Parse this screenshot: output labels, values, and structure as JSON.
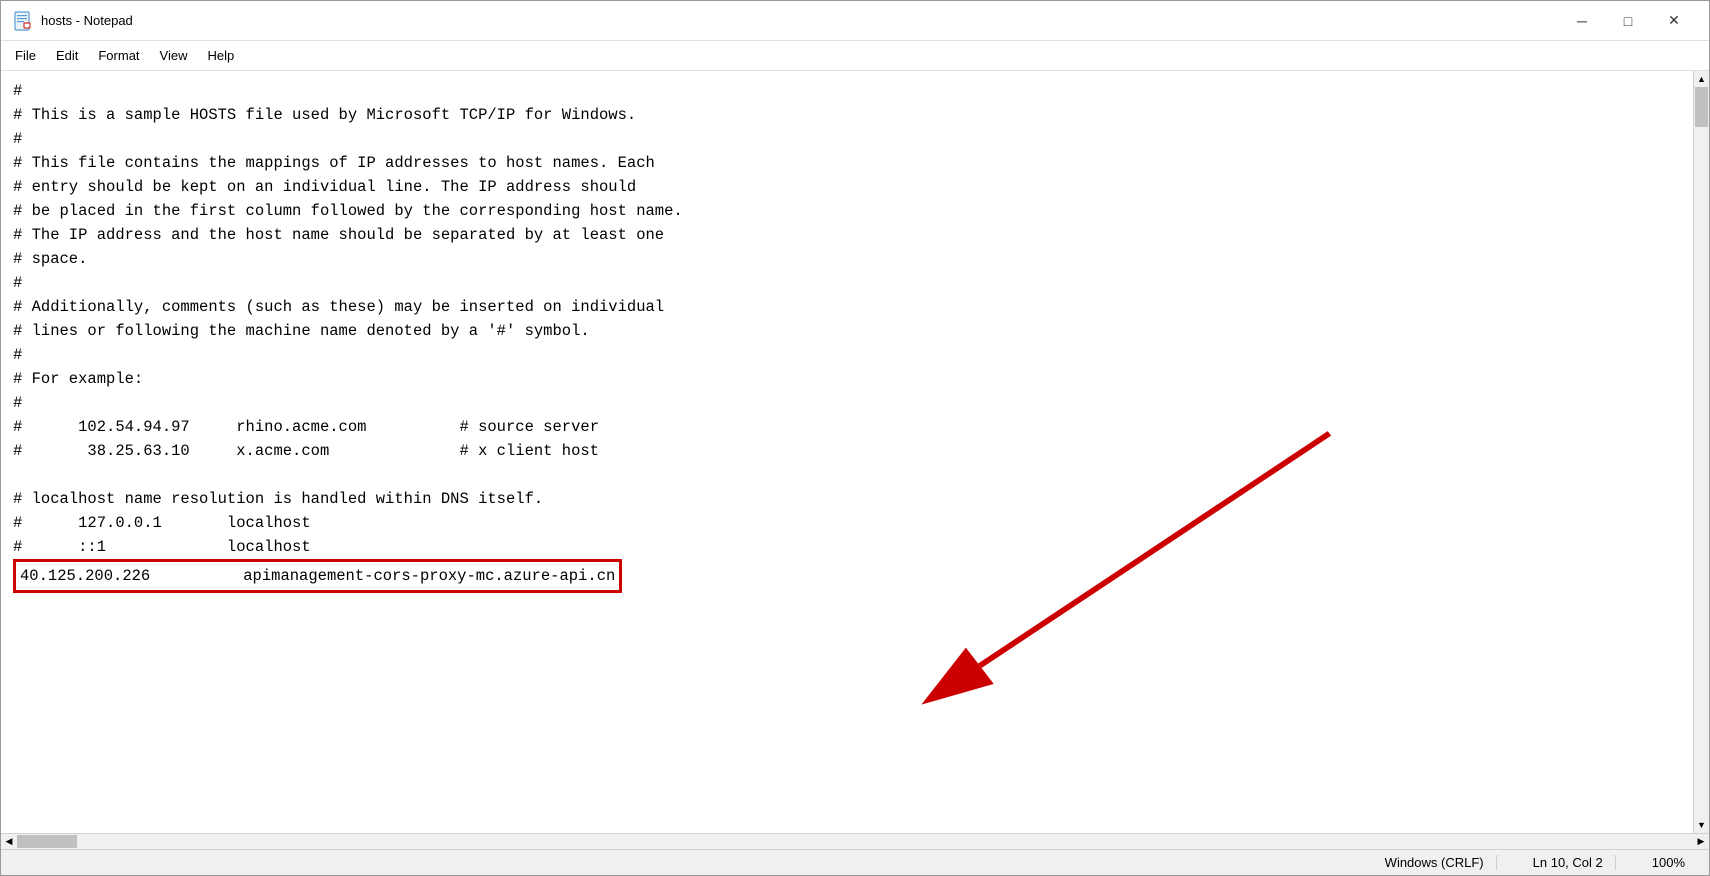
{
  "window": {
    "title": "hosts - Notepad",
    "icon": "notepad"
  },
  "titlebar": {
    "title": "hosts - Notepad",
    "minimize_label": "─",
    "maximize_label": "□",
    "close_label": "✕"
  },
  "menubar": {
    "items": [
      "File",
      "Edit",
      "Format",
      "View",
      "Help"
    ]
  },
  "editor": {
    "content_lines": [
      "#",
      "# This is a sample HOSTS file used by Microsoft TCP/IP for Windows.",
      "#",
      "# This file contains the mappings of IP addresses to host names. Each",
      "# entry should be kept on an individual line. The IP address should",
      "# be placed in the first column followed by the corresponding host name.",
      "# The IP address and the host name should be separated by at least one",
      "# space.",
      "#",
      "# Additionally, comments (such as these) may be inserted on individual",
      "# lines or following the machine name denoted by a '#' symbol.",
      "#",
      "# For example:",
      "#",
      "#      102.54.94.97     rhino.acme.com          # source server",
      "#       38.25.63.10     x.acme.com              # x client host",
      "",
      "# localhost name resolution is handled within DNS itself.",
      "#      127.0.0.1       localhost",
      "#      ::1             localhost"
    ],
    "highlighted_line": "40.125.200.226          apimanagement-cors-proxy-mc.azure-api.cn"
  },
  "statusbar": {
    "line_ending": "Windows (CRLF)",
    "position": "Ln 10, Col 2",
    "zoom": "100%"
  }
}
